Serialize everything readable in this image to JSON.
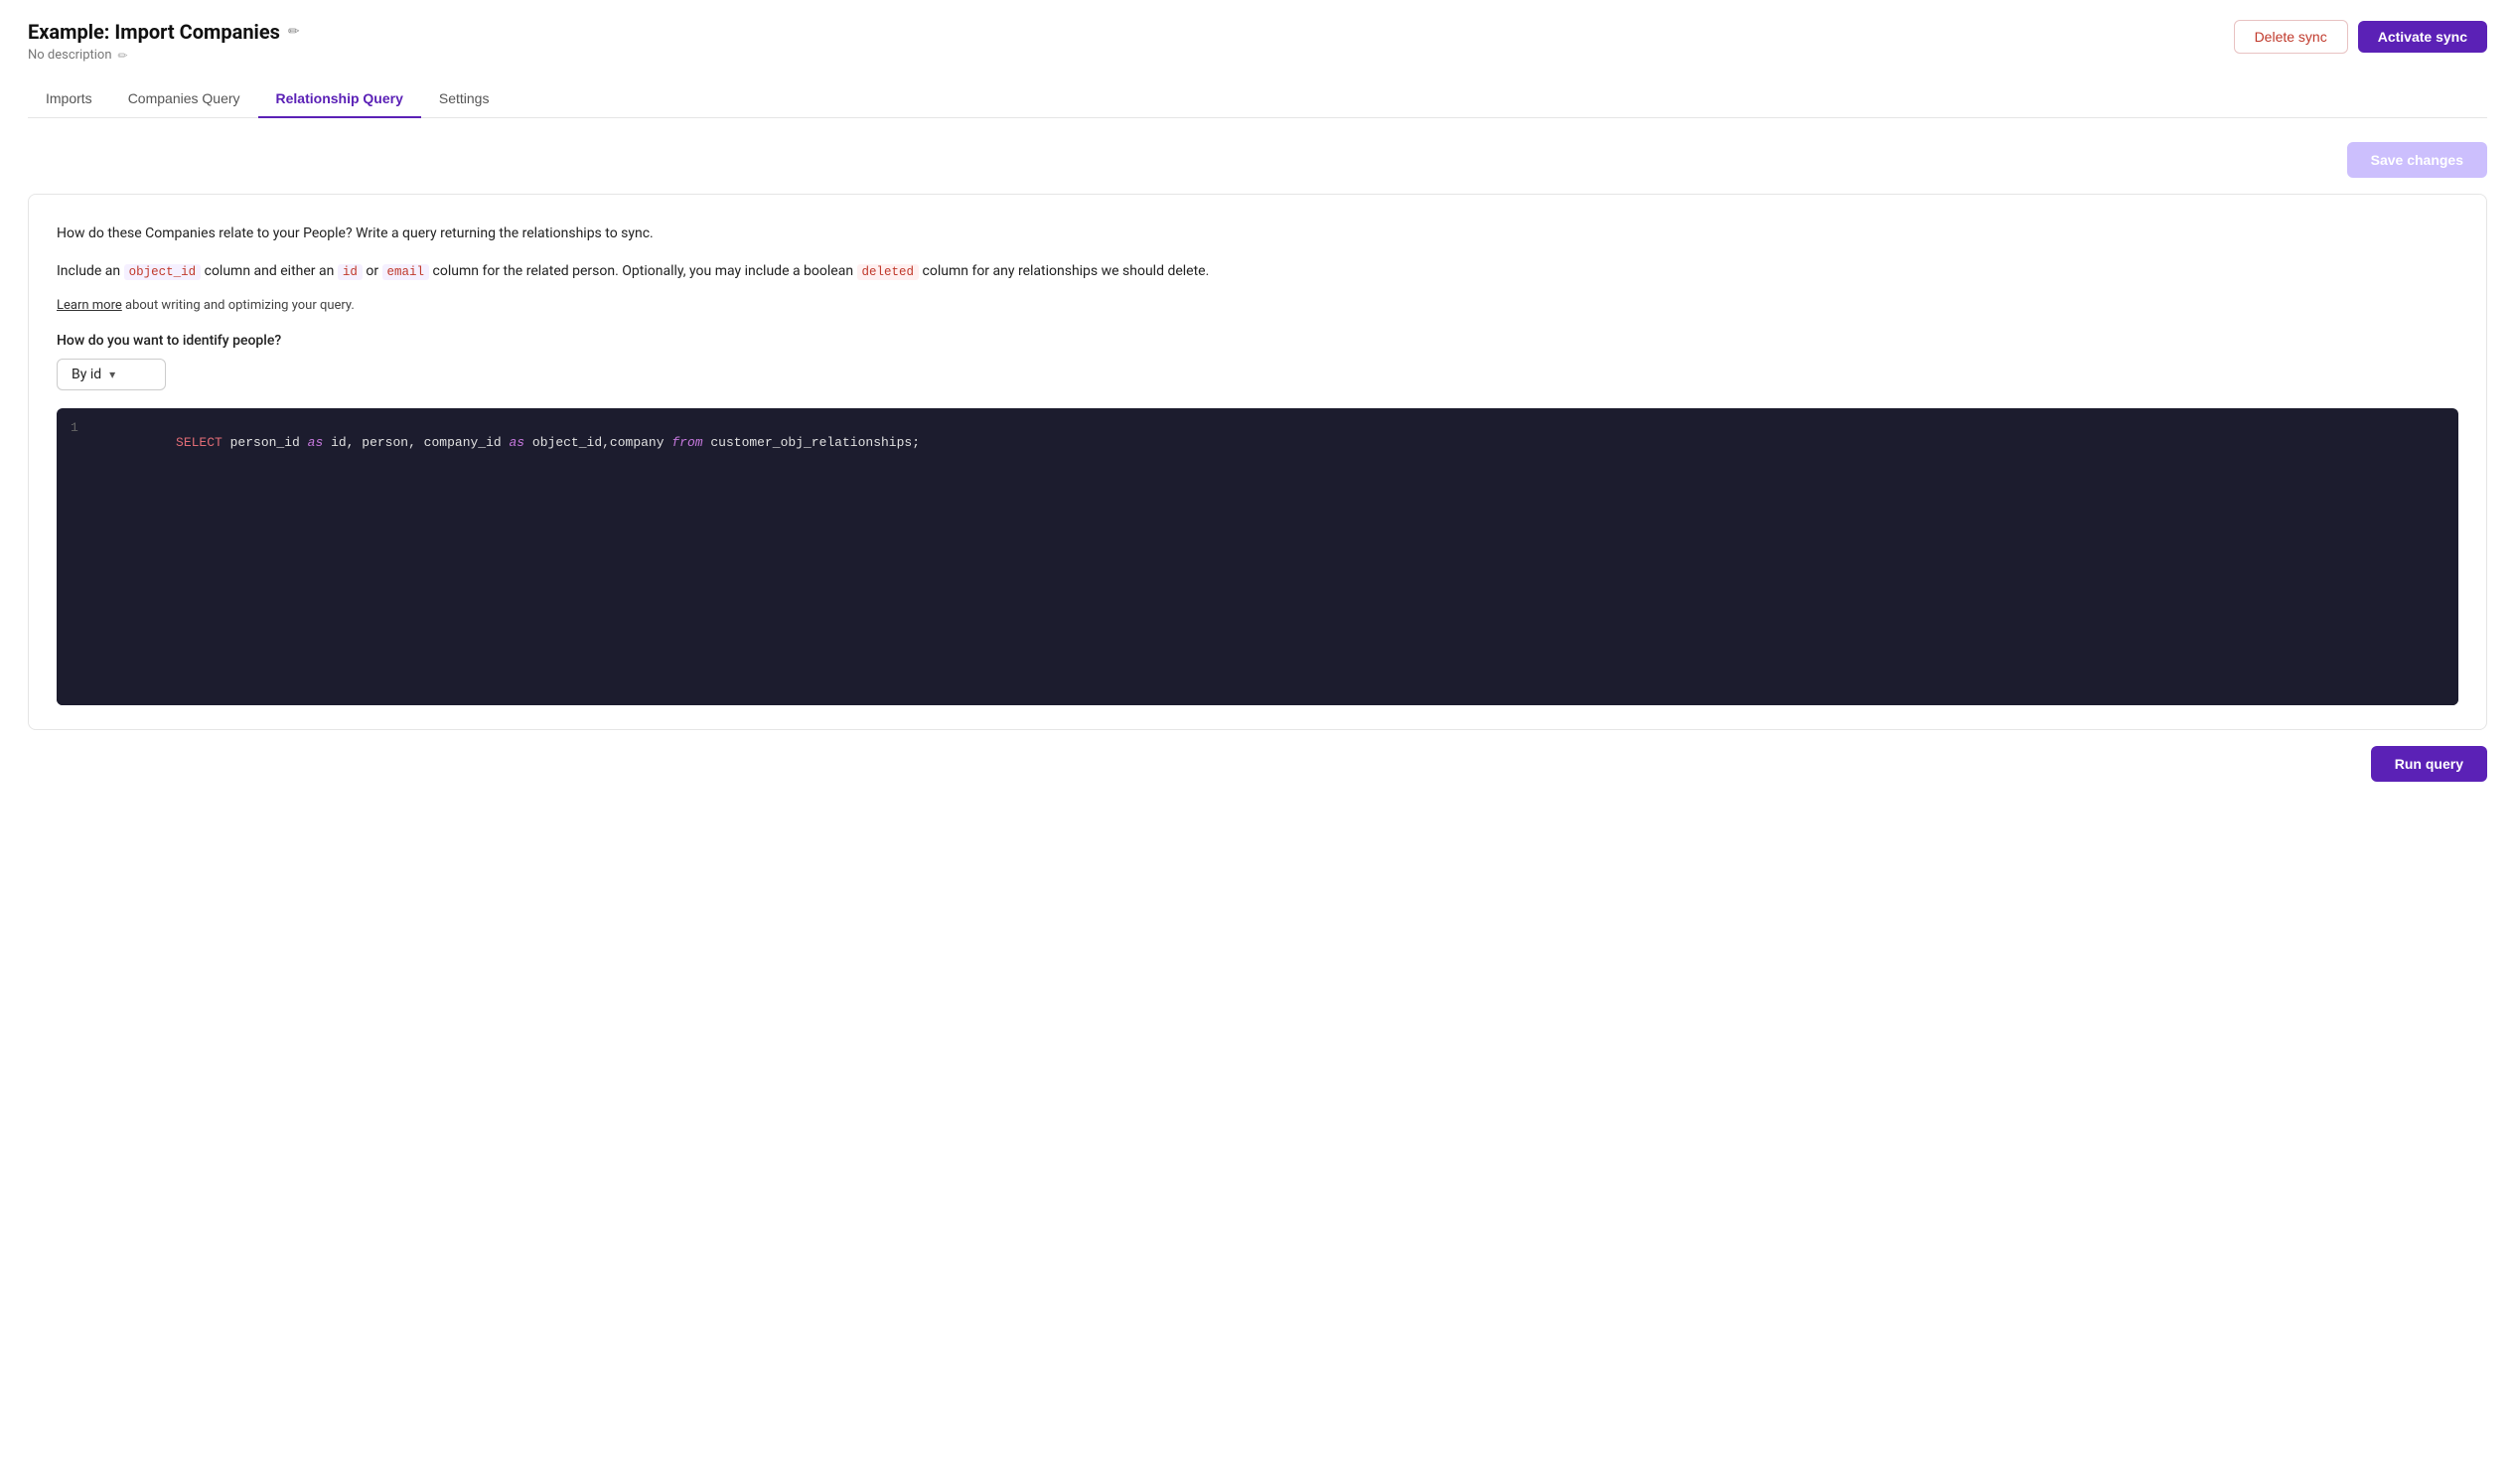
{
  "header": {
    "title": "Example: Import Companies",
    "description": "No description",
    "edit_icon": "✏",
    "desc_edit_icon": "✏"
  },
  "actions": {
    "delete_label": "Delete sync",
    "activate_label": "Activate sync"
  },
  "tabs": [
    {
      "id": "imports",
      "label": "Imports",
      "active": false
    },
    {
      "id": "companies-query",
      "label": "Companies Query",
      "active": false
    },
    {
      "id": "relationship-query",
      "label": "Relationship Query",
      "active": true
    },
    {
      "id": "settings",
      "label": "Settings",
      "active": false
    }
  ],
  "save_changes_label": "Save changes",
  "content": {
    "description1": "How do these Companies relate to your People? Write a query returning the relationships to sync.",
    "description2_prefix": "Include an ",
    "description2_object_id": "object_id",
    "description2_middle1": " column and either an ",
    "description2_id": "id",
    "description2_middle2": " or ",
    "description2_email": "email",
    "description2_middle3": " column for the related person. Optionally, you may include a boolean ",
    "description2_deleted": "deleted",
    "description2_suffix": " column for any relationships we should delete.",
    "learn_more_link": "Learn more",
    "learn_more_suffix": " about writing and optimizing your query.",
    "identify_label": "How do you want to identify people?",
    "dropdown_value": "By id",
    "code": {
      "line_number": "1",
      "select_keyword": "SELECT",
      "code_plain1": " person_id ",
      "as1": "as",
      "code_plain2": " id, person, company_id ",
      "as2": "as",
      "code_plain3": " object_id,company ",
      "from": "from",
      "code_plain4": " customer_obj_relationships;"
    }
  },
  "run_query_label": "Run query"
}
